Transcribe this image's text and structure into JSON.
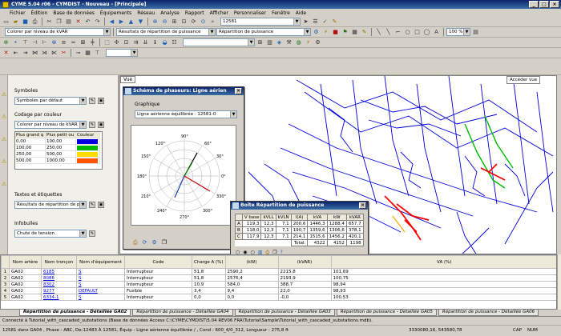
{
  "window": {
    "title": "CYME 5.04 r06 - CYMDIST - Nouveau - [Principale]"
  },
  "menu": [
    "Fichier",
    "Édition",
    "Base de données",
    "Équipements",
    "Réseau",
    "Analyse",
    "Rapport",
    "Afficher",
    "Personnaliser",
    "Fenêtre",
    "Aide"
  ],
  "toolbar": {
    "color_by": "Colorer par niveau de kVAR",
    "results_combo": "Résultats de répartition de puissance",
    "report_combo": "Répartition de puissance",
    "search_value": "12581",
    "zoom_value": "100 %"
  },
  "left_panel": {
    "symbols_label": "Symboles",
    "symbols_value": "Symboles par défaut",
    "color_label": "Codage par couleur",
    "color_value": "Colorer par niveau de kVAR",
    "grid_headers": [
      "Plus grand q",
      "Plus petit ou",
      "Couleur"
    ],
    "grid_rows": [
      {
        "a": "0,00",
        "b": "100,00",
        "color": "#0000dd"
      },
      {
        "a": "100,00",
        "b": "250,00",
        "color": "#00bb00"
      },
      {
        "a": "250,00",
        "b": "500,00",
        "color": "#ffdd00"
      },
      {
        "a": "500,00",
        "b": "1000,00",
        "color": "#ff5500"
      }
    ],
    "text_label": "Textes et étiquettes",
    "text_value": "Résultats de répartition de p",
    "intools_label": "Infobulles",
    "intools_value": "Chute de tension"
  },
  "map": {
    "tab_label": "Vue",
    "access_label": "Accéder vue"
  },
  "phasor": {
    "title": "Schéma de phaseurs: Ligne aérien",
    "graphic_label": "Graphique",
    "line_value": "Ligne aérienne équilibrée : 12581-0",
    "angles": [
      "90°",
      "60°",
      "30°",
      "0°",
      "330°",
      "300°",
      "270°",
      "240°",
      "210°",
      "180°",
      "150°",
      "120°"
    ]
  },
  "power_box": {
    "title": "Boîte Répartition de puissance",
    "headers": [
      "",
      "V base",
      "kVLL",
      "kVLN",
      "I(A)",
      "kVA",
      "kW",
      "kVAR"
    ],
    "rows": [
      [
        "A",
        "119,3",
        "12,3",
        "7,1",
        "200,6",
        "1446,3",
        "1288,4",
        "657,7"
      ],
      [
        "B",
        "118,0",
        "12,3",
        "7,1",
        "190,7",
        "1359,6",
        "1306,6",
        "378,1"
      ],
      [
        "C",
        "117,9",
        "12,3",
        "7,1",
        "214,1",
        "1515,6",
        "1456,2",
        "420,1"
      ],
      [
        "",
        "",
        "",
        "",
        "Total:",
        "4322",
        "4152",
        "1198"
      ]
    ]
  },
  "bottom_table": {
    "headers": [
      "",
      "Nom artère",
      "Nom tronçon",
      "Nom d'équipement",
      "Code",
      "Charge A (%)",
      "(kW)",
      "(kVAR)",
      "VA (%)"
    ],
    "rows": [
      [
        "1",
        "GA02",
        "6185",
        "S",
        "Interrupteur",
        "51,8",
        "2590,2",
        "2215,8",
        "101,69"
      ],
      [
        "2",
        "GA02",
        "8086",
        "S",
        "Interrupteur",
        "51,8",
        "2576,4",
        "2193,9",
        "100,75"
      ],
      [
        "3",
        "GA02",
        "8302",
        "S",
        "Interrupteur",
        "10,9",
        "584,0",
        "388,7",
        "98,94"
      ],
      [
        "4",
        "GA02",
        "9277",
        "DEFAULT",
        "Fusible",
        "3,4",
        "9,4",
        "22,0",
        "98,93"
      ],
      [
        "5",
        "GA02",
        "6334-1",
        "S",
        "Interrupteur",
        "0,0",
        "0,0",
        "-0,0",
        "100,53"
      ]
    ]
  },
  "tabs": [
    "Répartition de puissance - Détaillée GA02",
    "Répartition de puissance - Détaillée GA04",
    "Répartition de puissance - Détaillée GA03",
    "Répartition de puissance - Détaillée GA05",
    "Répartition de puissance - Détaillée GA06"
  ],
  "status": {
    "line1": "Connecté à Tutorial_with_cascaded_substations (Base de données Access C:\\CYME\\CYMDIST\\5.04 REV06 FRA\\Tutorial\\Sample\\Tutorial_with_cascaded_substations.mdb).",
    "line2": "12581 dans GA04 , Phase : ABC, De:12483 À 12581, Équip : Ligne aérienne équilibrée / , Cond : 600_4/0_312, Longueur :  275,8 ft",
    "coords": "3330080,16, 543580,78",
    "cap": "CAP",
    "num": "NUM"
  },
  "colors": {
    "title_bar": "#0a246a",
    "map_lines": "#0000dd",
    "overload": "#ff0000"
  }
}
